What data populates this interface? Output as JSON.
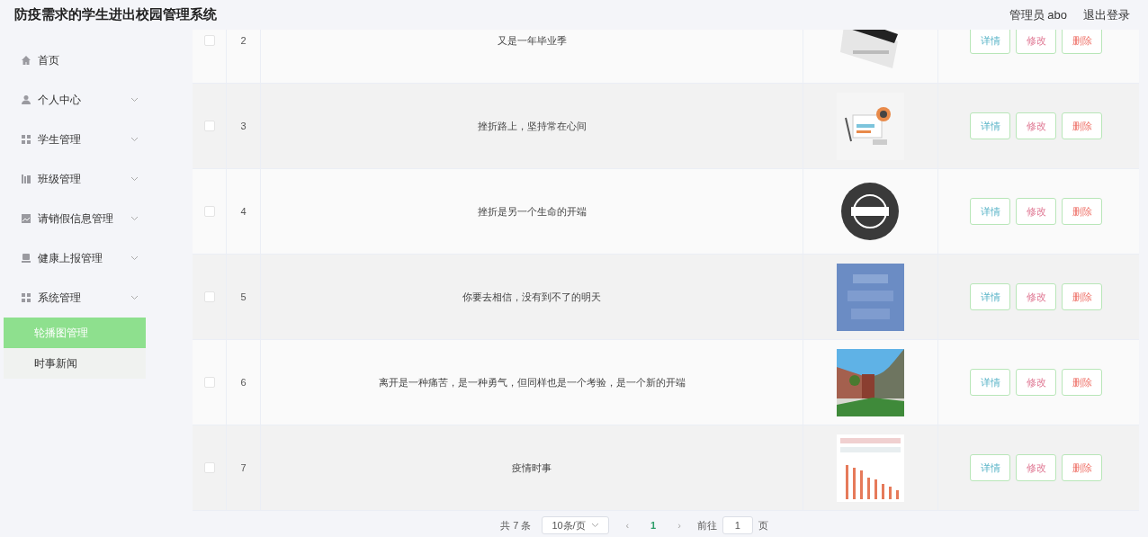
{
  "header": {
    "title": "防疫需求的学生进出校园管理系统",
    "user": "管理员 abo",
    "logout": "退出登录"
  },
  "sidebar": {
    "items": [
      {
        "label": "首页",
        "kind": "link"
      },
      {
        "label": "个人中心",
        "kind": "group"
      },
      {
        "label": "学生管理",
        "kind": "group"
      },
      {
        "label": "班级管理",
        "kind": "group"
      },
      {
        "label": "请销假信息管理",
        "kind": "group"
      },
      {
        "label": "健康上报管理",
        "kind": "group"
      },
      {
        "label": "系统管理",
        "kind": "group",
        "children": [
          {
            "label": "轮播图管理",
            "selected": true
          },
          {
            "label": "时事新闻",
            "selected": false
          }
        ]
      }
    ]
  },
  "table": {
    "rows": [
      {
        "index": "2",
        "title": "又是一年毕业季",
        "checked": false,
        "actions": [
          {
            "label": "详情",
            "kind": "detail"
          },
          {
            "label": "修改",
            "kind": "edit"
          },
          {
            "label": "删除",
            "kind": "delete"
          }
        ]
      },
      {
        "index": "3",
        "title": "挫折路上，坚持常在心间",
        "checked": false,
        "actions": [
          {
            "label": "详情",
            "kind": "detail"
          },
          {
            "label": "修改",
            "kind": "edit"
          },
          {
            "label": "删除",
            "kind": "delete"
          }
        ]
      },
      {
        "index": "4",
        "title": "挫折是另一个生命的开端",
        "checked": false,
        "actions": [
          {
            "label": "详情",
            "kind": "detail"
          },
          {
            "label": "修改",
            "kind": "edit"
          },
          {
            "label": "删除",
            "kind": "delete"
          }
        ]
      },
      {
        "index": "5",
        "title": "你要去相信，没有到不了的明天",
        "checked": false,
        "actions": [
          {
            "label": "详情",
            "kind": "detail"
          },
          {
            "label": "修改",
            "kind": "edit"
          },
          {
            "label": "删除",
            "kind": "delete"
          }
        ]
      },
      {
        "index": "6",
        "title": "离开是一种痛苦，是一种勇气，但同样也是一个考验，是一个新的开端",
        "checked": false,
        "actions": [
          {
            "label": "详情",
            "kind": "detail"
          },
          {
            "label": "修改",
            "kind": "edit"
          },
          {
            "label": "删除",
            "kind": "delete"
          }
        ]
      },
      {
        "index": "7",
        "title": "疫情时事",
        "checked": false,
        "actions": [
          {
            "label": "详情",
            "kind": "detail"
          },
          {
            "label": "修改",
            "kind": "edit"
          },
          {
            "label": "删除",
            "kind": "delete"
          }
        ]
      }
    ]
  },
  "pagination": {
    "total": "共 7 条",
    "page_size": "10条/页",
    "prev": "‹",
    "pages": [
      {
        "label": "1",
        "selected": true
      }
    ],
    "next": "›",
    "goto": "前往",
    "goto_value": "1",
    "page_unit": "页"
  }
}
